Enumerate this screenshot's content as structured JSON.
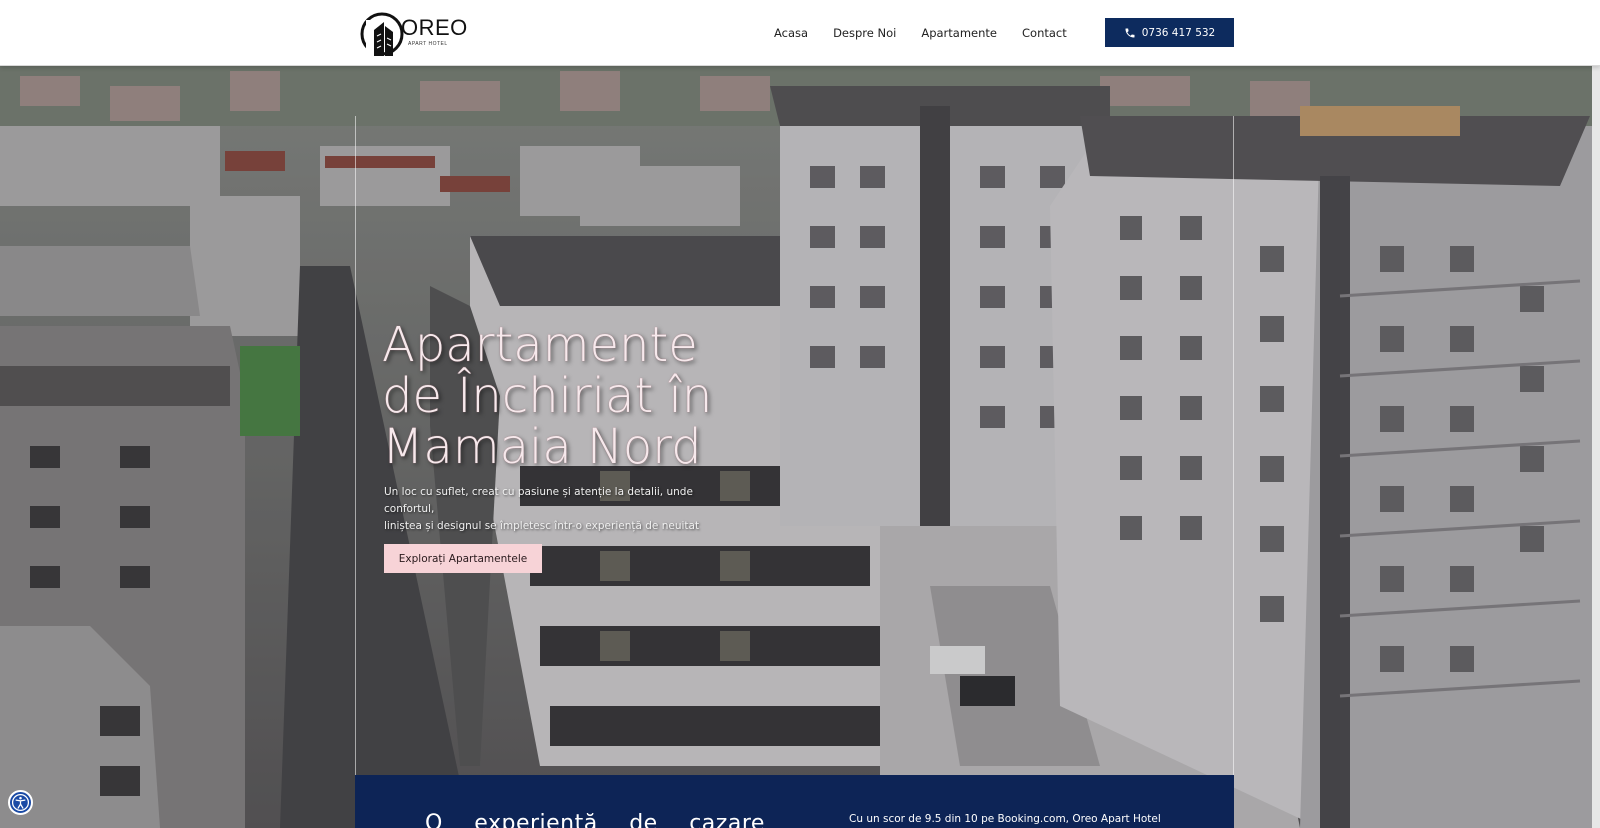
{
  "header": {
    "logo_name": "OREO",
    "logo_sub": "APART HOTEL",
    "nav": [
      "Acasa",
      "Despre Noi",
      "Apartamente",
      "Contact"
    ],
    "phone": "0736 417 532"
  },
  "hero": {
    "title_line1": "Apartamente",
    "title_line2": "de Închiriat în",
    "title_line3": "Mamaia Nord",
    "subtitle_line1": "Un loc cu suflet, creat cu pasiune și atenție la detalii, unde confortul,",
    "subtitle_line2": "liniștea și designul se împletesc într-o experiență de neuitat",
    "cta_label": "Explorați Apartamentele"
  },
  "panel": {
    "heading": "O experiență de cazare",
    "score_prefix": "Cu un scor de ",
    "score_value": "9.5 din 10 pe Booking.com",
    "score_suffix": ", Oreo Apart Hotel"
  },
  "colors": {
    "brand_blue": "#0d2b5e",
    "panel_blue": "#0d2456",
    "cta_pink": "#f7d3d7"
  },
  "icons": {
    "phone": "phone-icon",
    "accessibility": "accessibility-icon",
    "logo": "building-logo-icon"
  }
}
